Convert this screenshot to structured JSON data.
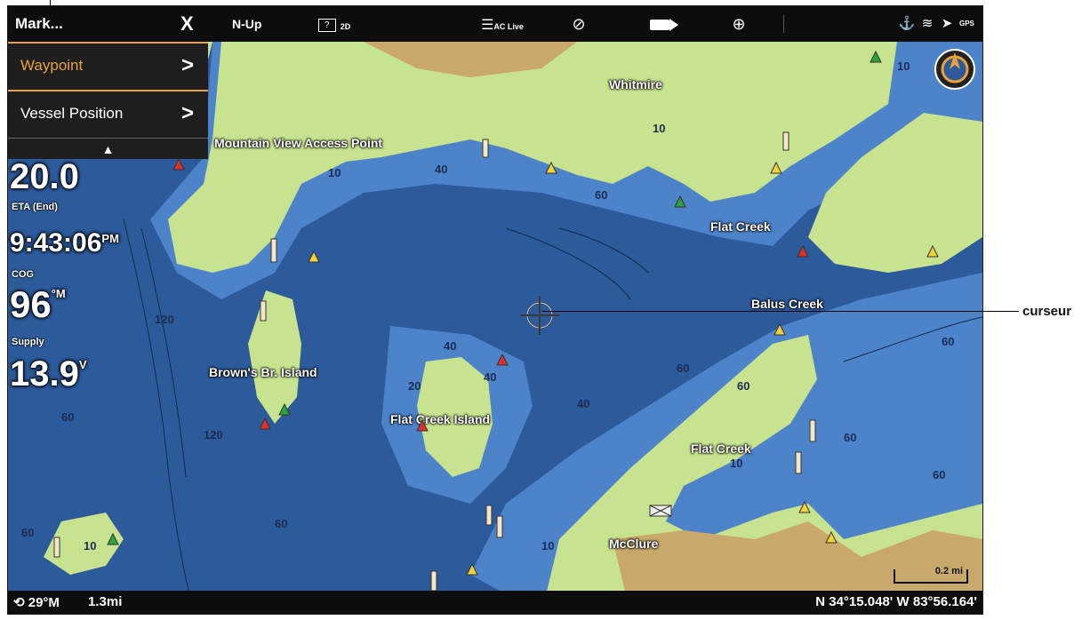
{
  "topbar": {
    "mark_label": "Mark...",
    "close_label": "X",
    "orientation_label": "N-Up",
    "view_2d_label": "2D",
    "ac_live_label": "AC Live",
    "gps_label": "GPS"
  },
  "mark_menu": {
    "items": [
      {
        "label": "Waypoint",
        "chevron": ">"
      },
      {
        "label": "Vessel Position",
        "chevron": ">"
      }
    ],
    "collapse_icon": "chevron-up-icon"
  },
  "data_overlay": {
    "speed_value": "20.0",
    "eta_label": "ETA (End)",
    "eta_value": "9:43:06",
    "eta_unit": "PM",
    "cog_label": "COG",
    "cog_value": "96",
    "cog_unit": "°M",
    "supply_label": "Supply",
    "supply_value": "13.9",
    "supply_unit": "V"
  },
  "map_labels": {
    "whitmire": "Whitmire",
    "mountain_view": "Mountain View Access Point",
    "flat_creek_top": "Flat Creek",
    "balus_creek": "Balus Creek",
    "browns_island": "Brown's Br. Island",
    "flat_creek_island": "Flat Creek Island",
    "flat_creek_bottom": "Flat Creek",
    "mcclure": "McClure"
  },
  "depth_labels": [
    "10",
    "40",
    "60",
    "120",
    "60",
    "10",
    "40",
    "60",
    "10",
    "60",
    "40",
    "10",
    "60",
    "20",
    "40",
    "60",
    "120",
    "60",
    "10",
    "60",
    "10",
    "60"
  ],
  "scale_bar": {
    "label": "0.2 mi"
  },
  "bottombar": {
    "heading": "29°M",
    "range": "1.3mi",
    "coordinates": "N 34°15.048' W 83°56.164'"
  },
  "callout": {
    "label": "curseur"
  },
  "colors": {
    "deep_water": "#2d5a9a",
    "shallow_water": "#8ec5ef",
    "land": "#c7e38f",
    "land_brown": "#c9a86b",
    "menu_accent": "#e9a23b"
  }
}
